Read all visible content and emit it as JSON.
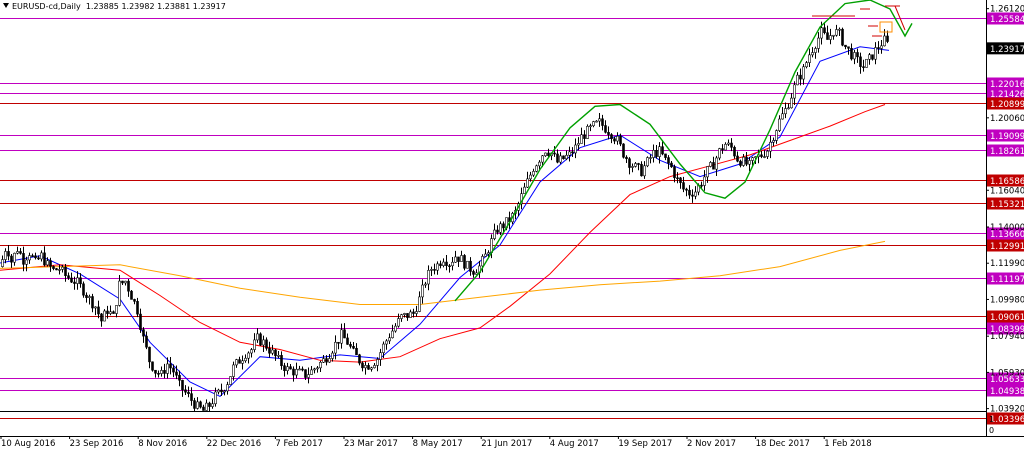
{
  "header": {
    "symbol": "EURUSD-cd,Daily",
    "open": "1.23885",
    "high": "1.23982",
    "low": "1.23881",
    "close": "1.23917"
  },
  "chart_data": {
    "type": "candlestick",
    "symbol": "EURUSD-cd",
    "timeframe": "Daily",
    "ylim": [
      1.024,
      1.266
    ],
    "x_labels": [
      "10 Aug 2016",
      "23 Sep 2016",
      "8 Nov 2016",
      "22 Dec 2016",
      "7 Feb 2017",
      "23 Mar 2017",
      "8 May 2017",
      "21 Jun 2017",
      "4 Aug 2017",
      "19 Sep 2017",
      "2 Nov 2017",
      "18 Dec 2017",
      "1 Feb 2018"
    ],
    "y_ticks": [
      "1.26120",
      "1.20060",
      "1.16040",
      "1.14000",
      "1.11990",
      "1.09980",
      "1.07940",
      "1.05930",
      "1.03920"
    ],
    "current_price": "1.23917",
    "horizontal_levels": [
      {
        "price": 1.25584,
        "label": "1.25584",
        "color": "#c000c0"
      },
      {
        "price": 1.22016,
        "label": "1.22016",
        "color": "#c000c0"
      },
      {
        "price": 1.21426,
        "label": "1.21426",
        "color": "#c000c0"
      },
      {
        "price": 1.20899,
        "label": "1.20899",
        "color": "#c00000"
      },
      {
        "price": 1.19099,
        "label": "1.19099",
        "color": "#c000c0"
      },
      {
        "price": 1.18261,
        "label": "1.18261",
        "color": "#c000c0"
      },
      {
        "price": 1.16586,
        "label": "1.16586",
        "color": "#c00000"
      },
      {
        "price": 1.15321,
        "label": "1.15321",
        "color": "#c00000"
      },
      {
        "price": 1.1366,
        "label": "1.13660",
        "color": "#c000c0"
      },
      {
        "price": 1.12991,
        "label": "1.12991",
        "color": "#c00000"
      },
      {
        "price": 1.11197,
        "label": "1.11197",
        "color": "#c000c0"
      },
      {
        "price": 1.09061,
        "label": "1.09061",
        "color": "#c00000"
      },
      {
        "price": 1.08399,
        "label": "1.08399",
        "color": "#c000c0"
      },
      {
        "price": 1.05633,
        "label": "1.05633",
        "color": "#c000c0"
      },
      {
        "price": 1.04938,
        "label": "1.04938",
        "color": "#c000c0"
      },
      {
        "price": 1.03396,
        "label": "1.03396",
        "color": "#c00000"
      }
    ],
    "close_path": [
      [
        0,
        1.118
      ],
      [
        6,
        1.13
      ],
      [
        11,
        1.121
      ],
      [
        17,
        1.128
      ],
      [
        23,
        1.122
      ],
      [
        29,
        1.126
      ],
      [
        35,
        1.12
      ],
      [
        41,
        1.124
      ],
      [
        47,
        1.119
      ],
      [
        53,
        1.116
      ],
      [
        59,
        1.117
      ],
      [
        65,
        1.113
      ],
      [
        71,
        1.111
      ],
      [
        77,
        1.109
      ],
      [
        83,
        1.105
      ],
      [
        89,
        1.1
      ],
      [
        95,
        1.096
      ],
      [
        101,
        1.088
      ],
      [
        107,
        1.094
      ],
      [
        113,
        1.09
      ],
      [
        119,
        1.108
      ],
      [
        125,
        1.11
      ],
      [
        131,
        1.102
      ],
      [
        137,
        1.094
      ],
      [
        143,
        1.078
      ],
      [
        149,
        1.066
      ],
      [
        155,
        1.06
      ],
      [
        161,
        1.058
      ],
      [
        167,
        1.064
      ],
      [
        173,
        1.06
      ],
      [
        179,
        1.052
      ],
      [
        185,
        1.048
      ],
      [
        191,
        1.044
      ],
      [
        197,
        1.04
      ],
      [
        203,
        1.038
      ],
      [
        209,
        1.041
      ],
      [
        215,
        1.046
      ],
      [
        221,
        1.049
      ],
      [
        227,
        1.054
      ],
      [
        233,
        1.062
      ],
      [
        239,
        1.066
      ],
      [
        245,
        1.07
      ],
      [
        251,
        1.072
      ],
      [
        257,
        1.078
      ],
      [
        263,
        1.076
      ],
      [
        269,
        1.072
      ],
      [
        275,
        1.068
      ],
      [
        281,
        1.064
      ],
      [
        287,
        1.061
      ],
      [
        293,
        1.06
      ],
      [
        299,
        1.059
      ],
      [
        305,
        1.058
      ],
      [
        311,
        1.06
      ],
      [
        317,
        1.063
      ],
      [
        323,
        1.066
      ],
      [
        329,
        1.07
      ],
      [
        335,
        1.075
      ],
      [
        341,
        1.08
      ],
      [
        347,
        1.076
      ],
      [
        353,
        1.07
      ],
      [
        359,
        1.066
      ],
      [
        365,
        1.063
      ],
      [
        371,
        1.064
      ],
      [
        377,
        1.067
      ],
      [
        383,
        1.074
      ],
      [
        389,
        1.08
      ],
      [
        395,
        1.085
      ],
      [
        401,
        1.09
      ],
      [
        407,
        1.091
      ],
      [
        413,
        1.092
      ],
      [
        419,
        1.1
      ],
      [
        425,
        1.11
      ],
      [
        431,
        1.117
      ],
      [
        437,
        1.119
      ],
      [
        443,
        1.123
      ],
      [
        449,
        1.12
      ],
      [
        455,
        1.124
      ],
      [
        461,
        1.122
      ],
      [
        467,
        1.118
      ],
      [
        473,
        1.116
      ],
      [
        479,
        1.118
      ],
      [
        485,
        1.124
      ],
      [
        491,
        1.132
      ],
      [
        497,
        1.139
      ],
      [
        503,
        1.141
      ],
      [
        509,
        1.144
      ],
      [
        515,
        1.148
      ],
      [
        521,
        1.157
      ],
      [
        527,
        1.165
      ],
      [
        533,
        1.173
      ],
      [
        539,
        1.178
      ],
      [
        545,
        1.183
      ],
      [
        551,
        1.181
      ],
      [
        557,
        1.176
      ],
      [
        563,
        1.178
      ],
      [
        569,
        1.18
      ],
      [
        575,
        1.184
      ],
      [
        581,
        1.19
      ],
      [
        587,
        1.193
      ],
      [
        593,
        1.196
      ],
      [
        599,
        1.198
      ],
      [
        605,
        1.195
      ],
      [
        611,
        1.192
      ],
      [
        617,
        1.188
      ],
      [
        623,
        1.181
      ],
      [
        629,
        1.176
      ],
      [
        635,
        1.173
      ],
      [
        641,
        1.171
      ],
      [
        647,
        1.176
      ],
      [
        653,
        1.181
      ],
      [
        659,
        1.182
      ],
      [
        665,
        1.177
      ],
      [
        671,
        1.173
      ],
      [
        677,
        1.166
      ],
      [
        683,
        1.161
      ],
      [
        689,
        1.159
      ],
      [
        695,
        1.16
      ],
      [
        701,
        1.165
      ],
      [
        707,
        1.171
      ],
      [
        713,
        1.175
      ],
      [
        719,
        1.182
      ],
      [
        725,
        1.186
      ],
      [
        731,
        1.184
      ],
      [
        737,
        1.178
      ],
      [
        743,
        1.176
      ],
      [
        749,
        1.174
      ],
      [
        755,
        1.178
      ],
      [
        761,
        1.18
      ],
      [
        767,
        1.183
      ],
      [
        773,
        1.191
      ],
      [
        779,
        1.199
      ],
      [
        785,
        1.205
      ],
      [
        791,
        1.213
      ],
      [
        797,
        1.222
      ],
      [
        803,
        1.227
      ],
      [
        809,
        1.236
      ],
      [
        815,
        1.242
      ],
      [
        821,
        1.248
      ],
      [
        827,
        1.244
      ],
      [
        833,
        1.249
      ],
      [
        839,
        1.247
      ],
      [
        845,
        1.24
      ],
      [
        851,
        1.236
      ],
      [
        857,
        1.232
      ],
      [
        863,
        1.229
      ],
      [
        869,
        1.233
      ],
      [
        875,
        1.238
      ],
      [
        881,
        1.242
      ],
      [
        885,
        1.244
      ],
      [
        889,
        1.239
      ]
    ],
    "moving_averages": [
      {
        "color": "#0000ff",
        "points": [
          [
            0,
            1.12
          ],
          [
            40,
            1.124
          ],
          [
            80,
            1.114
          ],
          [
            120,
            1.1
          ],
          [
            150,
            1.076
          ],
          [
            190,
            1.054
          ],
          [
            220,
            1.046
          ],
          [
            260,
            1.068
          ],
          [
            300,
            1.066
          ],
          [
            340,
            1.069
          ],
          [
            380,
            1.067
          ],
          [
            420,
            1.086
          ],
          [
            460,
            1.112
          ],
          [
            500,
            1.13
          ],
          [
            540,
            1.165
          ],
          [
            580,
            1.184
          ],
          [
            620,
            1.191
          ],
          [
            660,
            1.177
          ],
          [
            700,
            1.168
          ],
          [
            740,
            1.175
          ],
          [
            780,
            1.19
          ],
          [
            820,
            1.232
          ],
          [
            860,
            1.24
          ],
          [
            889,
            1.238
          ]
        ]
      },
      {
        "color": "#ff0000",
        "points": [
          [
            0,
            1.116
          ],
          [
            60,
            1.119
          ],
          [
            120,
            1.116
          ],
          [
            160,
            1.102
          ],
          [
            200,
            1.087
          ],
          [
            240,
            1.076
          ],
          [
            280,
            1.072
          ],
          [
            320,
            1.066
          ],
          [
            360,
            1.065
          ],
          [
            400,
            1.068
          ],
          [
            440,
            1.078
          ],
          [
            480,
            1.084
          ],
          [
            510,
            1.096
          ],
          [
            550,
            1.114
          ],
          [
            590,
            1.137
          ],
          [
            630,
            1.158
          ],
          [
            670,
            1.168
          ],
          [
            710,
            1.174
          ],
          [
            750,
            1.18
          ],
          [
            790,
            1.188
          ],
          [
            830,
            1.196
          ],
          [
            865,
            1.204
          ],
          [
            885,
            1.208
          ]
        ]
      },
      {
        "color": "#ffa500",
        "points": [
          [
            0,
            1.117
          ],
          [
            60,
            1.118
          ],
          [
            120,
            1.119
          ],
          [
            180,
            1.113
          ],
          [
            240,
            1.106
          ],
          [
            300,
            1.101
          ],
          [
            360,
            1.097
          ],
          [
            420,
            1.097
          ],
          [
            480,
            1.101
          ],
          [
            540,
            1.105
          ],
          [
            600,
            1.108
          ],
          [
            660,
            1.11
          ],
          [
            720,
            1.113
          ],
          [
            780,
            1.118
          ],
          [
            840,
            1.127
          ],
          [
            885,
            1.132
          ]
        ]
      }
    ],
    "green_curve": [
      [
        455,
        1.099
      ],
      [
        480,
        1.115
      ],
      [
        510,
        1.143
      ],
      [
        540,
        1.172
      ],
      [
        570,
        1.195
      ],
      [
        595,
        1.207
      ],
      [
        620,
        1.208
      ],
      [
        650,
        1.197
      ],
      [
        680,
        1.175
      ],
      [
        705,
        1.159
      ],
      [
        725,
        1.156
      ],
      [
        745,
        1.165
      ],
      [
        770,
        1.194
      ],
      [
        795,
        1.226
      ],
      [
        820,
        1.251
      ],
      [
        845,
        1.264
      ],
      [
        870,
        1.266
      ],
      [
        890,
        1.261
      ],
      [
        900,
        1.251
      ],
      [
        905,
        1.246
      ],
      [
        912,
        1.253
      ]
    ]
  }
}
